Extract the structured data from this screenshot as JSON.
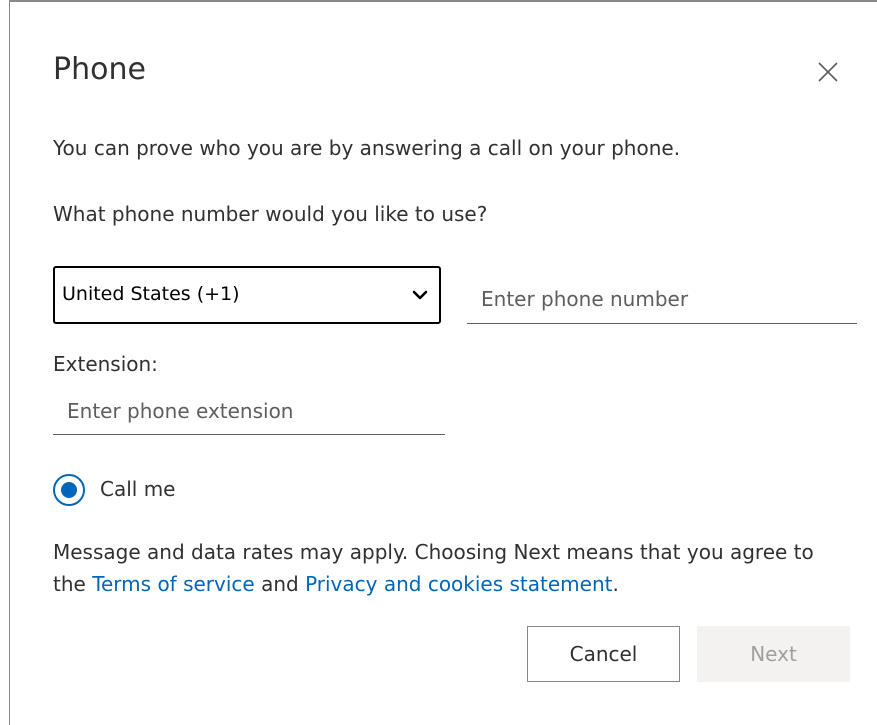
{
  "dialog": {
    "title": "Phone",
    "close_icon": "close-icon",
    "intro": "You can prove who you are by answering a call on your phone.",
    "question": "What phone number would you like to use?"
  },
  "country_select": {
    "value": "United States (+1)",
    "chevron_icon": "chevron-down-icon"
  },
  "phone_input": {
    "value": "",
    "placeholder": "Enter phone number"
  },
  "extension": {
    "label": "Extension:",
    "value": "",
    "placeholder": "Enter phone extension"
  },
  "method": {
    "label": "Call me",
    "selected": true
  },
  "disclaimer": {
    "text_before": "Message and data rates may apply. Choosing Next means that you agree to the ",
    "terms_link": "Terms of service",
    "text_and": " and ",
    "privacy_link": "Privacy and cookies statement",
    "text_after": "."
  },
  "buttons": {
    "cancel": "Cancel",
    "next": "Next",
    "next_disabled": true
  },
  "colors": {
    "accent": "#0067b8",
    "text": "#323130",
    "disabled_bg": "#f3f2f1",
    "disabled_text": "#a19f9d"
  }
}
